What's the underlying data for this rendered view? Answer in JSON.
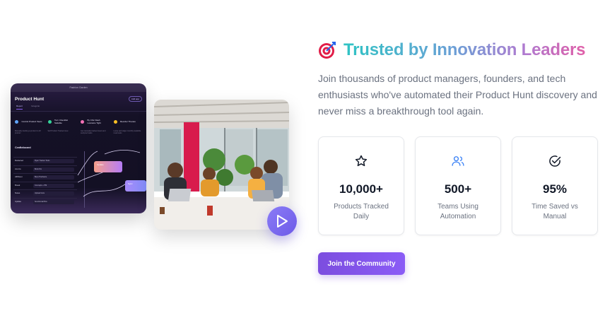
{
  "media": {
    "app_screenshot": {
      "window_title": "Fashion Garden",
      "app_title": "Product Hunt",
      "header_button": "Add app",
      "tabs": [
        "Report",
        "Incognito"
      ],
      "features": [
        {
          "title": "Control Product Team",
          "desc": "Manually tracking a product to 20 product",
          "color": "#60a5fa"
        },
        {
          "title": "Turn Checklist Satiable",
          "desc": "Self Product Tracked view",
          "color": "#34d399"
        },
        {
          "title": "By Chic Dash Lanceice Tight",
          "desc": "Get manually tracked views and analyzed tasks",
          "color": "#f472b6"
        },
        {
          "title": "Reorder Thereto",
          "desc": "Loose and target monthly available meal tasks",
          "color": "#fbbf24"
        }
      ],
      "dashboard_title": "Crafteboard",
      "rows": [
        {
          "label": "Redacted",
          "value": "Ryan Tracker Tools"
        },
        {
          "label": "Acorns",
          "value": "Book Nix"
        },
        {
          "label": "AltSheet",
          "value": "Bees Hardware"
        },
        {
          "label": "Break",
          "value": "Concepts + PM"
        },
        {
          "label": "Notes",
          "value": "Upload fonts"
        },
        {
          "label": "Update",
          "value": "Send Email Box"
        }
      ],
      "pill_primary": "Update",
      "pill_secondary": "Sync"
    },
    "photo_alt": "team-collaborating-in-office",
    "play_icon": "play-icon"
  },
  "hero": {
    "icon": "target-icon",
    "title": "Trusted by Innovation Leaders",
    "subtitle": "Join thousands of product managers, founders, and tech enthusiasts who've automated their Product Hunt discovery and never miss a breakthrough tool again."
  },
  "stats": [
    {
      "icon": "star-icon",
      "value": "10,000+",
      "label": "Products Tracked Daily"
    },
    {
      "icon": "users-icon",
      "value": "500+",
      "label": "Teams Using Automation"
    },
    {
      "icon": "check-circle-icon",
      "value": "95%",
      "label": "Time Saved vs Manual"
    }
  ],
  "cta": {
    "label": "Join the Community"
  },
  "colors": {
    "accent": "#7c4ddf",
    "play_button": "#6d5ae8",
    "users_icon": "#3b82f6"
  }
}
